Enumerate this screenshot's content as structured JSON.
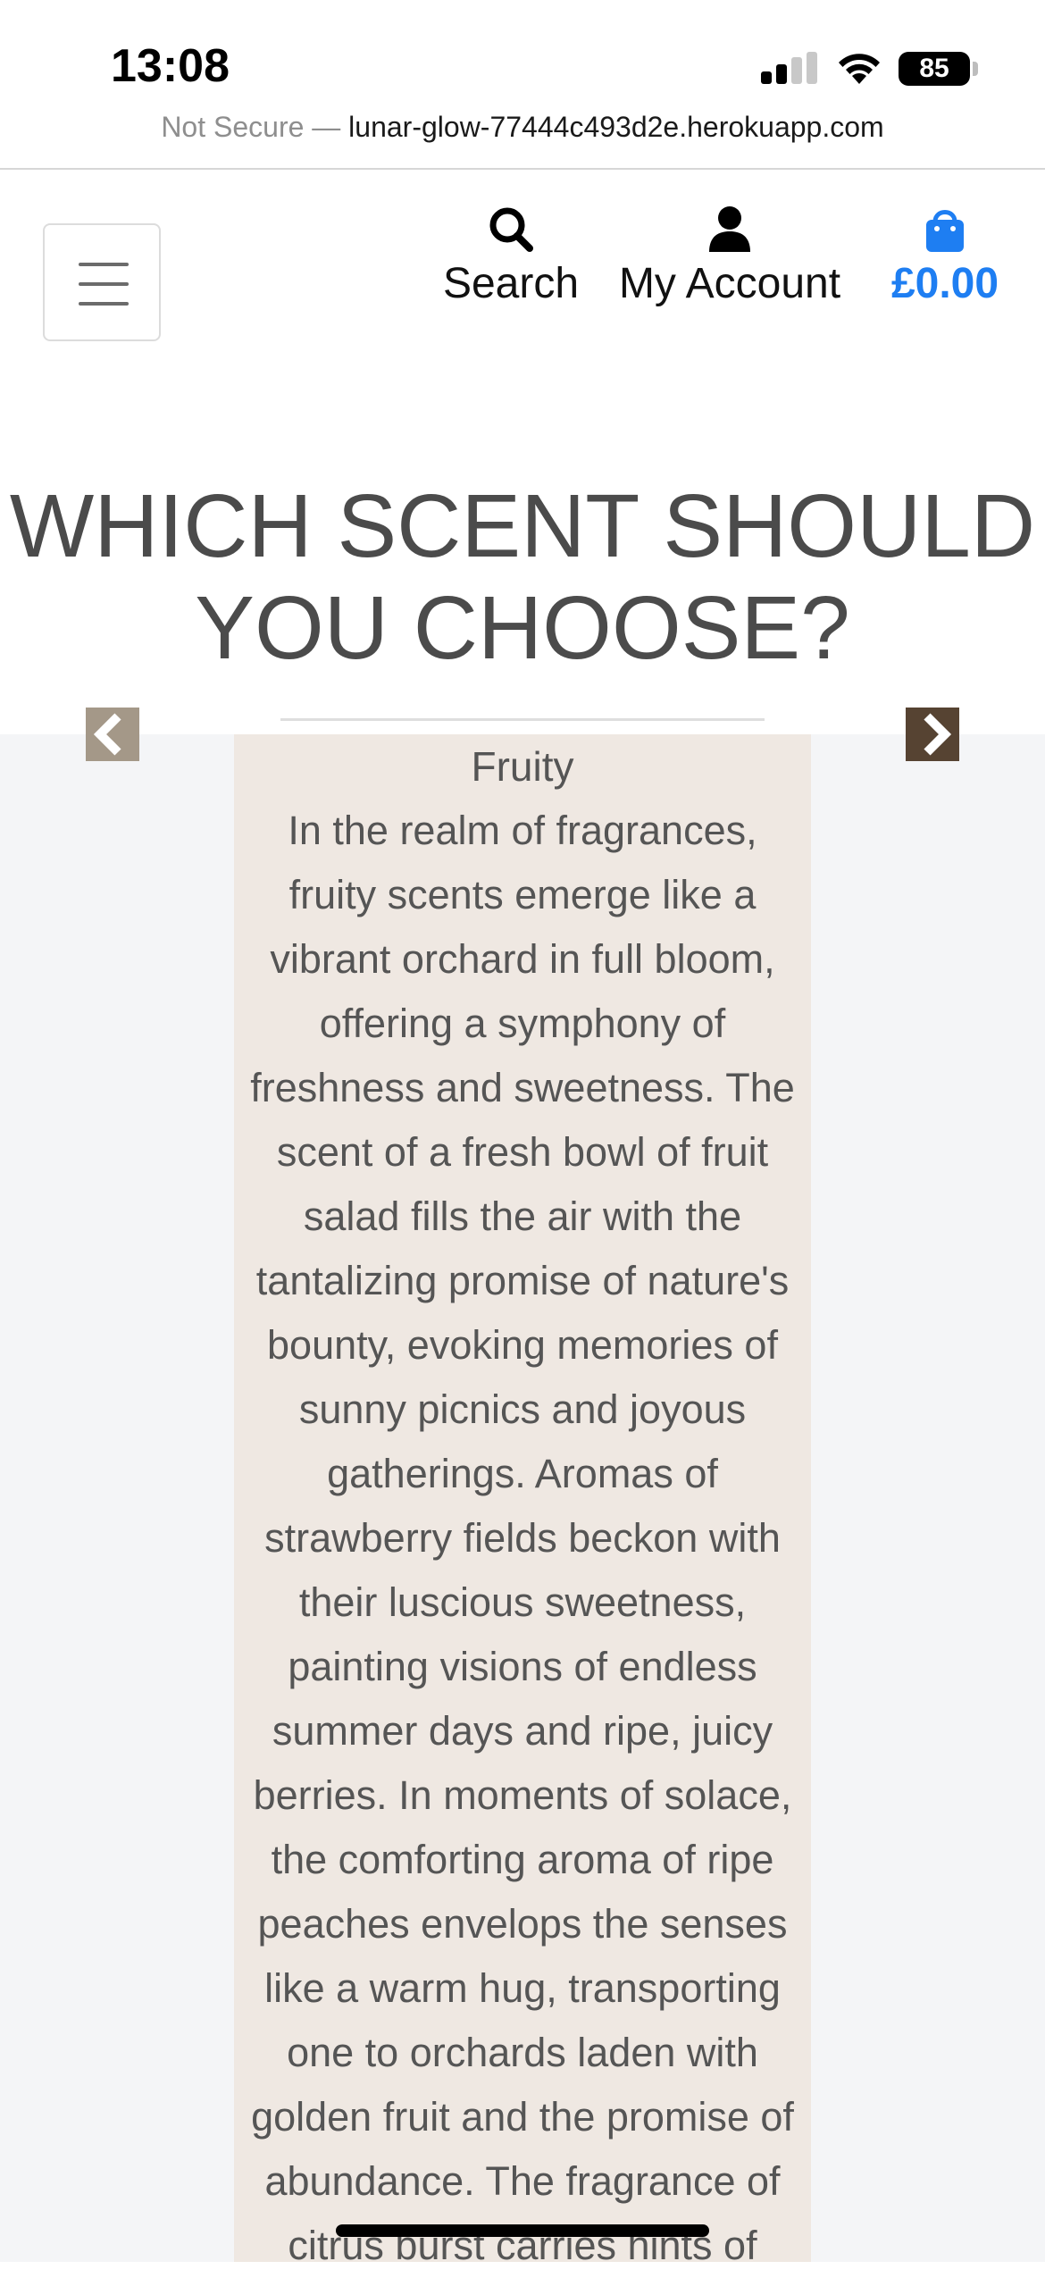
{
  "status_bar": {
    "time": "13:08",
    "battery": "85",
    "not_secure": "Not Secure —",
    "host": "lunar-glow-77444c493d2e.herokuapp.com"
  },
  "header": {
    "search_label": "Search",
    "account_label": "My Account",
    "cart_total": "£0.00",
    "accent_color": "#1e7ef2"
  },
  "page": {
    "heading": "WHICH SCENT SHOULD YOU CHOOSE?"
  },
  "carousel": {
    "slide_title": "Fruity",
    "slide_body": "In the realm of fragrances, fruity scents emerge like a vibrant orchard in full bloom, offering a symphony of freshness and sweetness. The scent of a fresh bowl of fruit salad fills the air with the tantalizing promise of nature's bounty, evoking memories of sunny picnics and joyous gatherings. Aromas of strawberry fields beckon with their luscious sweetness, painting visions of endless summer days and ripe, juicy berries. In moments of solace, the comforting aroma of ripe peaches envelops the senses like a warm hug, transporting one to orchards laden with golden fruit and the promise of abundance. The fragrance of citrus burst carries hints of",
    "prev_icon": "chevron-left-icon",
    "next_icon": "chevron-right-icon"
  }
}
